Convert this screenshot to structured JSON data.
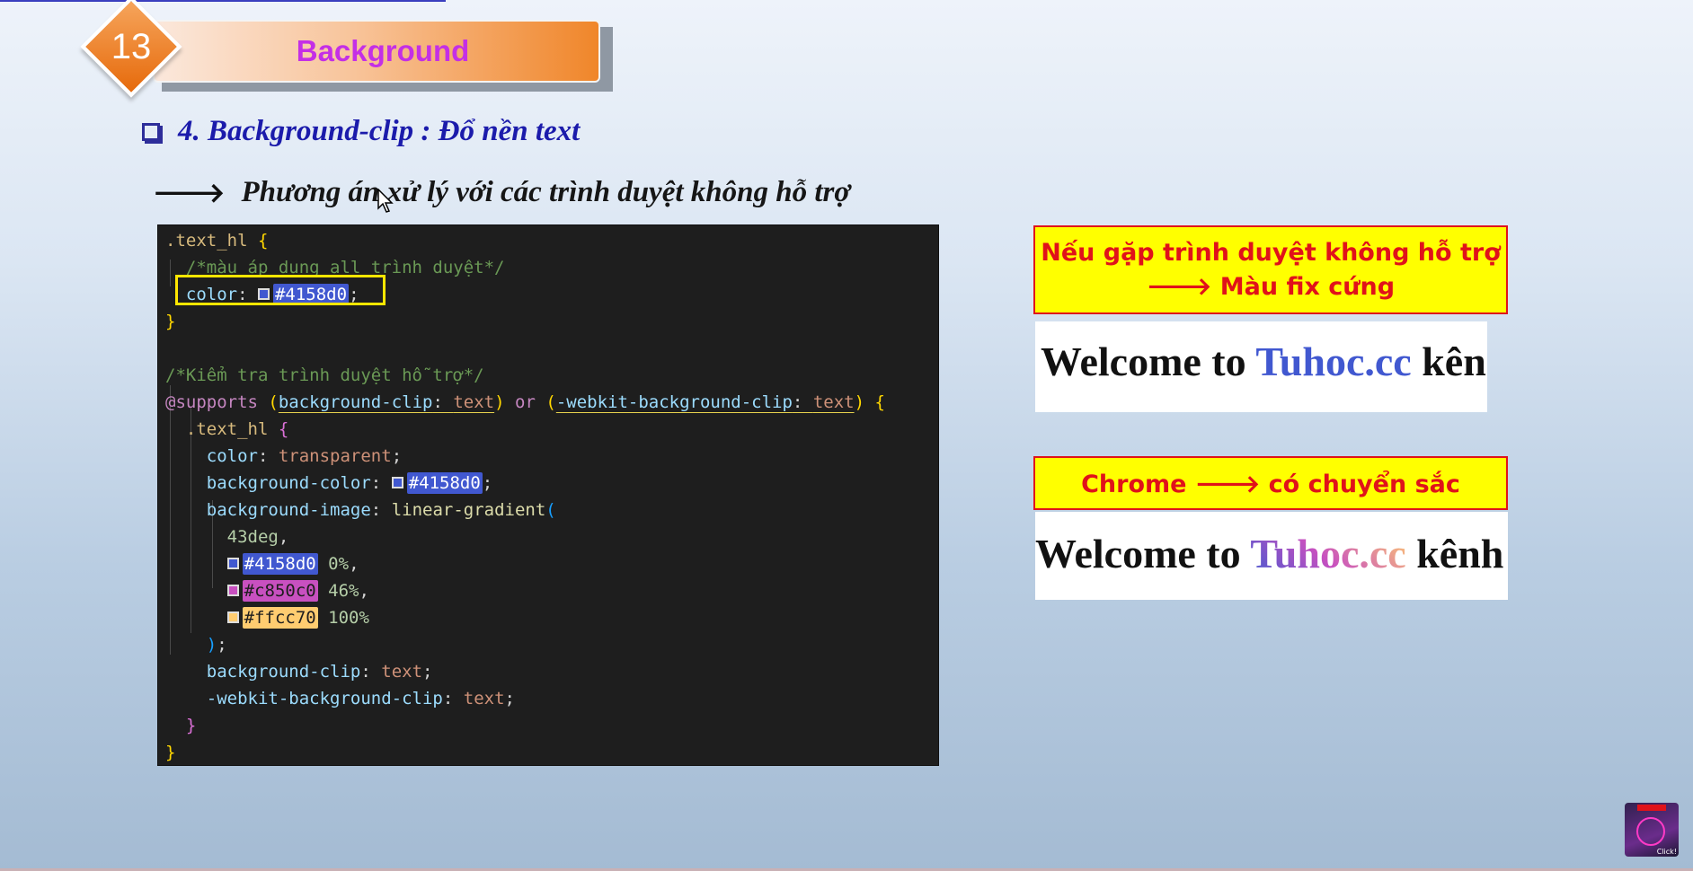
{
  "slide": {
    "number": "13",
    "title": "Background",
    "heading": "4. Background-clip : Đổ nền text",
    "subheading": "Phương án xử lý với các trình duyệt không hỗ trợ",
    "arrow_glyph": "🡒"
  },
  "code": {
    "sel1": ".text_hl",
    "brace_open": "{",
    "brace_close": "}",
    "comment1": "/*màu áp dụng all trình duyệt*/",
    "color_prop": "color",
    "color_value": "#4158d0",
    "comment2": "/*Kiểm tra trình duyệt hỗ trợ*/",
    "supports_kw": "@supports",
    "supports_cond1_prop": "background-clip",
    "supports_cond1_val": "text",
    "or_kw": "or",
    "supports_cond2_prop": "-webkit-background-clip",
    "supports_cond2_val": "text",
    "sel2": ".text_hl",
    "color_transparent": "transparent",
    "bgcolor_prop": "background-color",
    "bgimage_prop": "background-image",
    "gradient_fn": "linear-gradient",
    "angle": "43deg",
    "stops": [
      {
        "color": "#4158d0",
        "pos": "0%"
      },
      {
        "color": "#c850c0",
        "pos": "46%"
      },
      {
        "color": "#ffcc70",
        "pos": "100%"
      }
    ],
    "bgclip_prop": "background-clip",
    "webkit_bgclip_prop": "-webkit-background-clip",
    "text_val": "text"
  },
  "notes": {
    "note1_line1": "Nếu gặp trình duyệt không hỗ trợ",
    "note1_line2": "🡒 Màu fix cứng",
    "note2": "Chrome 🡒 có chuyển sắc"
  },
  "demo": {
    "prefix": "Welcome to ",
    "highlight": "Tuhoc.cc",
    "suffix1": " kên",
    "suffix2": " kênh"
  },
  "badge": {
    "label": "Click!"
  },
  "colors": {
    "primary": "#4158d0",
    "mid": "#c850c0",
    "end": "#ffcc70",
    "note_bg": "#ffff00",
    "note_text": "#e0121a",
    "title_color": "#c42fe6"
  }
}
